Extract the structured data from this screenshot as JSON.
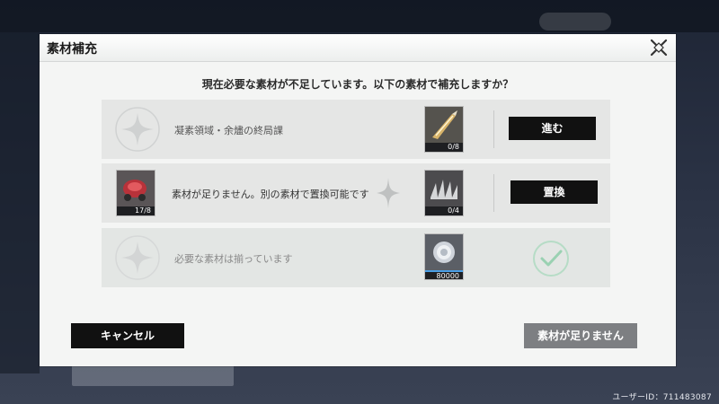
{
  "dialog": {
    "title": "素材補充",
    "question": "現在必要な素材が不足しています。以下の素材で補充しますか？",
    "rows": [
      {
        "text": "凝素領域・余燼の終局課",
        "item_icon": "feather-blade-icon",
        "item_count": "0/8",
        "action": "進む"
      },
      {
        "text": "素材が足りません。別の素材で置換可能です",
        "source_icon": "red-mech-icon",
        "source_count": "17/8",
        "item_icon": "spiked-claw-icon",
        "item_count": "0/4",
        "action": "置換"
      },
      {
        "text": "必要な素材は揃っています",
        "item_icon": "coin-icon",
        "item_count": "80000",
        "status_icon": "check-icon"
      }
    ],
    "cancel_label": "キャンセル",
    "shortage_label": "素材が足りません"
  },
  "footer": {
    "user_id": "ユーザーID：711483087"
  },
  "colors": {
    "dialog_bg": "#f4f5f4",
    "button_dark": "#111111",
    "button_disabled": "#7d7f82",
    "shortage_count": "#f2a36b",
    "check": "#9ad1b2"
  }
}
